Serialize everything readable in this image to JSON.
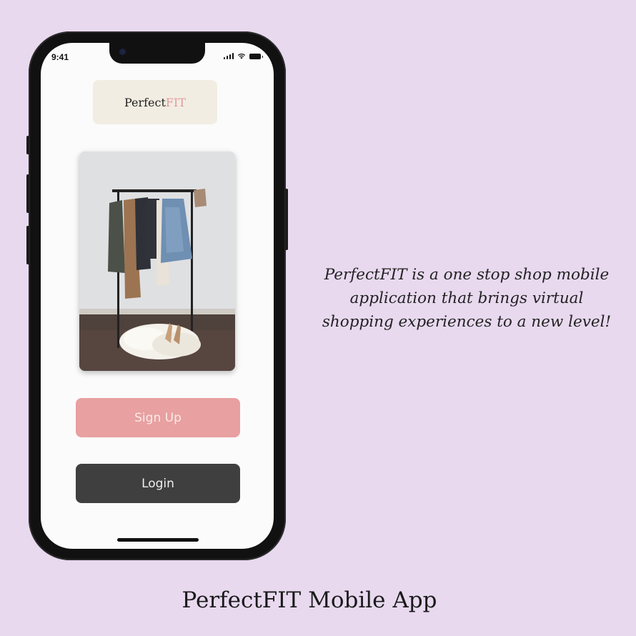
{
  "status_bar": {
    "time": "9:41"
  },
  "logo": {
    "prefix": "Perfect",
    "suffix": "FIT"
  },
  "hero_image": {
    "description_icon": "clothing-rack-photo"
  },
  "buttons": {
    "signup_label": "Sign Up",
    "login_label": "Login"
  },
  "tagline": "PerfectFIT is a one stop shop mobile application that brings virtual shopping experiences to a new level!",
  "footer_title": "PerfectFIT Mobile App",
  "colors": {
    "background": "#e8d9ef",
    "signup": "#e8a0a0",
    "login": "#3f3f3f",
    "logo_box": "#f2ede2",
    "fit_accent": "#e39a9a"
  }
}
